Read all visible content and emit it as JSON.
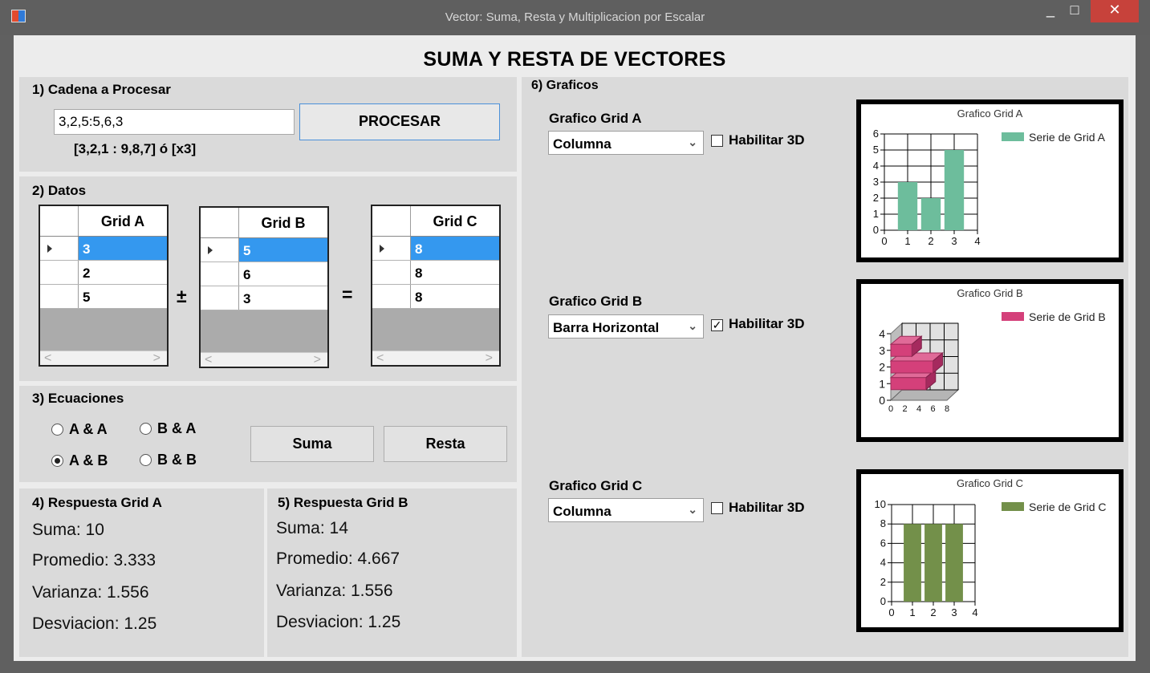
{
  "window": {
    "title": "Vector: Suma, Resta y Multiplicacion por Escalar",
    "minimize": "_",
    "maximize": "□",
    "close": "✕"
  },
  "header": {
    "title": "SUMA Y RESTA DE VECTORES"
  },
  "section1": {
    "title": "1) Cadena a Procesar",
    "input_value": "3,2,5:5,6,3",
    "button": "PROCESAR",
    "hint": "[3,2,1 : 9,8,7] ó [x3]"
  },
  "section2": {
    "title": "2) Datos",
    "grid_a": {
      "title": "Grid A",
      "rows": [
        "3",
        "2",
        "5"
      ]
    },
    "grid_b": {
      "title": "Grid B",
      "rows": [
        "5",
        "6",
        "3"
      ]
    },
    "grid_c": {
      "title": "Grid C",
      "rows": [
        "8",
        "8",
        "8"
      ]
    },
    "op1": "±",
    "op2": "=",
    "scroll_left": "<",
    "scroll_right": ">"
  },
  "section3": {
    "title": "3) Ecuaciones",
    "options": [
      "A & A",
      "B & A",
      "A & B",
      "B & B"
    ],
    "selected": "A & B",
    "suma": "Suma",
    "resta": "Resta"
  },
  "section4": {
    "title": "4) Respuesta Grid A",
    "suma": "Suma: 10",
    "promedio": "Promedio: 3.333",
    "varianza": "Varianza: 1.556",
    "desviacion": "Desviacion: 1.25"
  },
  "section5": {
    "title": "5) Respuesta Grid B",
    "suma": "Suma: 14",
    "promedio": "Promedio: 4.667",
    "varianza": "Varianza: 1.556",
    "desviacion": "Desviacion: 1.25"
  },
  "section6": {
    "title": "6) Graficos",
    "charts": [
      {
        "label": "Grafico Grid A",
        "type_selected": "Columna",
        "enable3d_label": "Habilitar 3D",
        "enable3d": false
      },
      {
        "label": "Grafico Grid B",
        "type_selected": "Barra Horizontal",
        "enable3d_label": "Habilitar 3D",
        "enable3d": true
      },
      {
        "label": "Grafico Grid C",
        "type_selected": "Columna",
        "enable3d_label": "Habilitar 3D",
        "enable3d": false
      }
    ]
  },
  "chart_data": [
    {
      "type": "bar",
      "title": "Grafico Grid A",
      "series": [
        {
          "name": "Serie de Grid A",
          "x": [
            1,
            2,
            3
          ],
          "values": [
            3,
            2,
            5
          ]
        }
      ],
      "color": "#6dbd9c",
      "xlim": [
        0,
        4
      ],
      "ylim": [
        0,
        6
      ],
      "xticks": [
        "0",
        "1",
        "2",
        "3",
        "4"
      ],
      "yticks": [
        "0",
        "1",
        "2",
        "3",
        "4",
        "5",
        "6"
      ],
      "grid": true,
      "legend": "top-right"
    },
    {
      "type": "bar",
      "orientation": "horizontal",
      "3d": true,
      "title": "Grafico Grid B",
      "series": [
        {
          "name": "Serie de Grid B",
          "y": [
            1,
            2,
            3
          ],
          "values": [
            5,
            6,
            3
          ]
        }
      ],
      "color": "#d4407a",
      "xlim": [
        0,
        8
      ],
      "ylim": [
        0,
        4
      ],
      "xticks": [
        "0",
        "2",
        "4",
        "6",
        "8"
      ],
      "yticks": [
        "0",
        "1",
        "2",
        "3",
        "4"
      ],
      "grid": true,
      "legend": "top-right"
    },
    {
      "type": "bar",
      "title": "Grafico Grid C",
      "series": [
        {
          "name": "Serie de Grid C",
          "x": [
            1,
            2,
            3
          ],
          "values": [
            8,
            8,
            8
          ]
        }
      ],
      "color": "#73904a",
      "xlim": [
        0,
        4
      ],
      "ylim": [
        0,
        10
      ],
      "xticks": [
        "0",
        "1",
        "2",
        "3",
        "4"
      ],
      "yticks": [
        "0",
        "2",
        "4",
        "6",
        "8",
        "10"
      ],
      "grid": true,
      "legend": "top-right"
    }
  ]
}
